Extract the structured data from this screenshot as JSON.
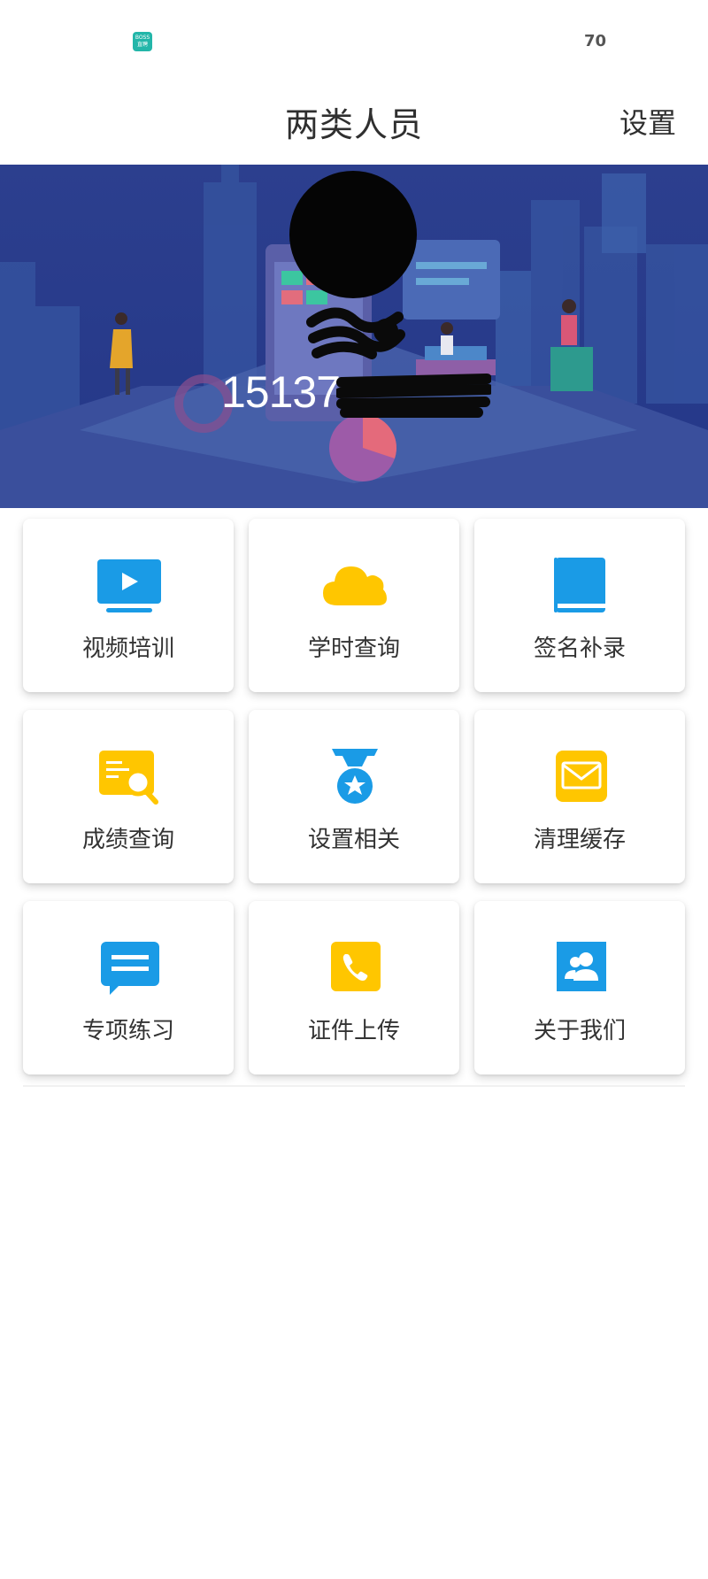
{
  "status_bar": {
    "app_badge": "BOSS直聘",
    "battery": "70"
  },
  "header": {
    "title": "两类人员",
    "settings_label": "设置"
  },
  "profile": {
    "phone_visible": "15137"
  },
  "menu": [
    {
      "label": "视频培训",
      "icon": "video-play-icon",
      "color": "#1a9be6"
    },
    {
      "label": "学时查询",
      "icon": "cloud-icon",
      "color": "#ffc600"
    },
    {
      "label": "签名补录",
      "icon": "book-icon",
      "color": "#1a9be6"
    },
    {
      "label": "成绩查询",
      "icon": "report-search-icon",
      "color": "#ffc600"
    },
    {
      "label": "设置相关",
      "icon": "medal-star-icon",
      "color": "#1a9be6"
    },
    {
      "label": "清理缓存",
      "icon": "envelope-icon",
      "color": "#ffc600"
    },
    {
      "label": "专项练习",
      "icon": "chat-bubble-icon",
      "color": "#1a9be6"
    },
    {
      "label": "证件上传",
      "icon": "phone-icon",
      "color": "#ffc600"
    },
    {
      "label": "关于我们",
      "icon": "contacts-icon",
      "color": "#1a9be6"
    }
  ]
}
